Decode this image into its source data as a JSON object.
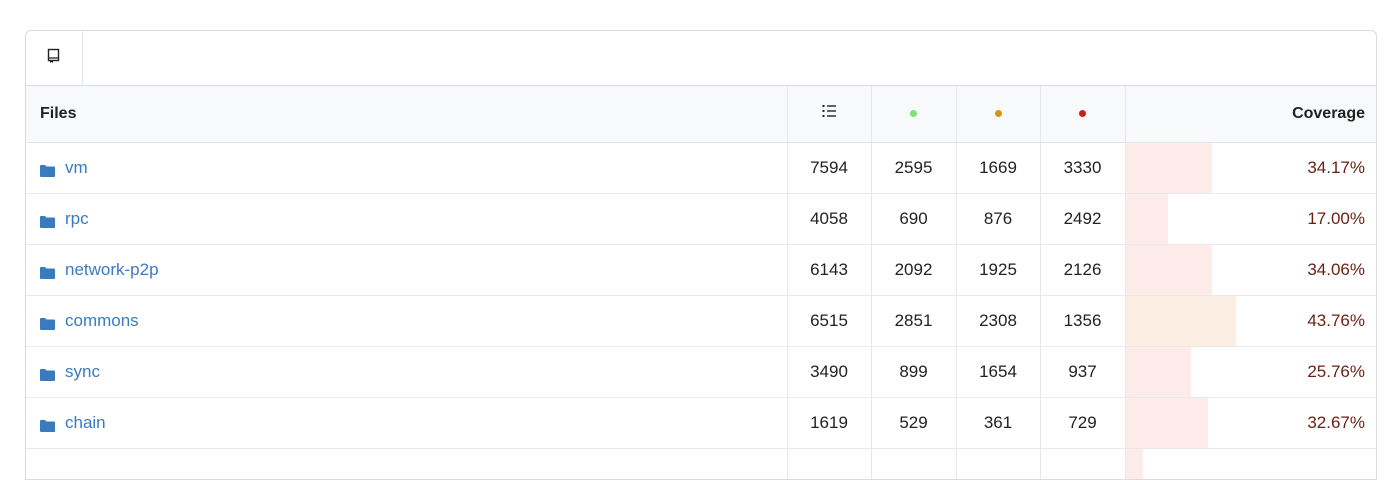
{
  "toolbar": {
    "tree_icon": "tree-toggle-icon"
  },
  "table": {
    "headers": {
      "files": "Files",
      "lines_icon": "list-ordered-icon",
      "covered_dot_color": "#7ee07e",
      "partial_dot_color": "#d4950f",
      "missed_dot_color": "#d11a1a",
      "coverage": "Coverage"
    },
    "rows": [
      {
        "name": "vm",
        "lines": "7594",
        "hits": "2595",
        "partials": "1669",
        "misses": "3330",
        "coverage_pct": 34.17,
        "coverage": "34.17%"
      },
      {
        "name": "rpc",
        "lines": "4058",
        "hits": "690",
        "partials": "876",
        "misses": "2492",
        "coverage_pct": 17.0,
        "coverage": "17.00%"
      },
      {
        "name": "network-p2p",
        "lines": "6143",
        "hits": "2092",
        "partials": "1925",
        "misses": "2126",
        "coverage_pct": 34.06,
        "coverage": "34.06%"
      },
      {
        "name": "commons",
        "lines": "6515",
        "hits": "2851",
        "partials": "2308",
        "misses": "1356",
        "coverage_pct": 43.76,
        "coverage": "43.76%"
      },
      {
        "name": "sync",
        "lines": "3490",
        "hits": "899",
        "partials": "1654",
        "misses": "937",
        "coverage_pct": 25.76,
        "coverage": "25.76%"
      },
      {
        "name": "chain",
        "lines": "1619",
        "hits": "529",
        "partials": "361",
        "misses": "729",
        "coverage_pct": 32.67,
        "coverage": "32.67%"
      },
      {
        "name": "",
        "lines": "",
        "hits": "",
        "partials": "",
        "misses": "",
        "coverage_pct": 7.0,
        "coverage": ""
      }
    ]
  },
  "colors": {
    "link": "#3a7bbf",
    "folder": "#3a7bbf",
    "coverage_text": "#6b1f12",
    "bar_low": "#fdecea",
    "bar_mid": "#fdeee3"
  }
}
